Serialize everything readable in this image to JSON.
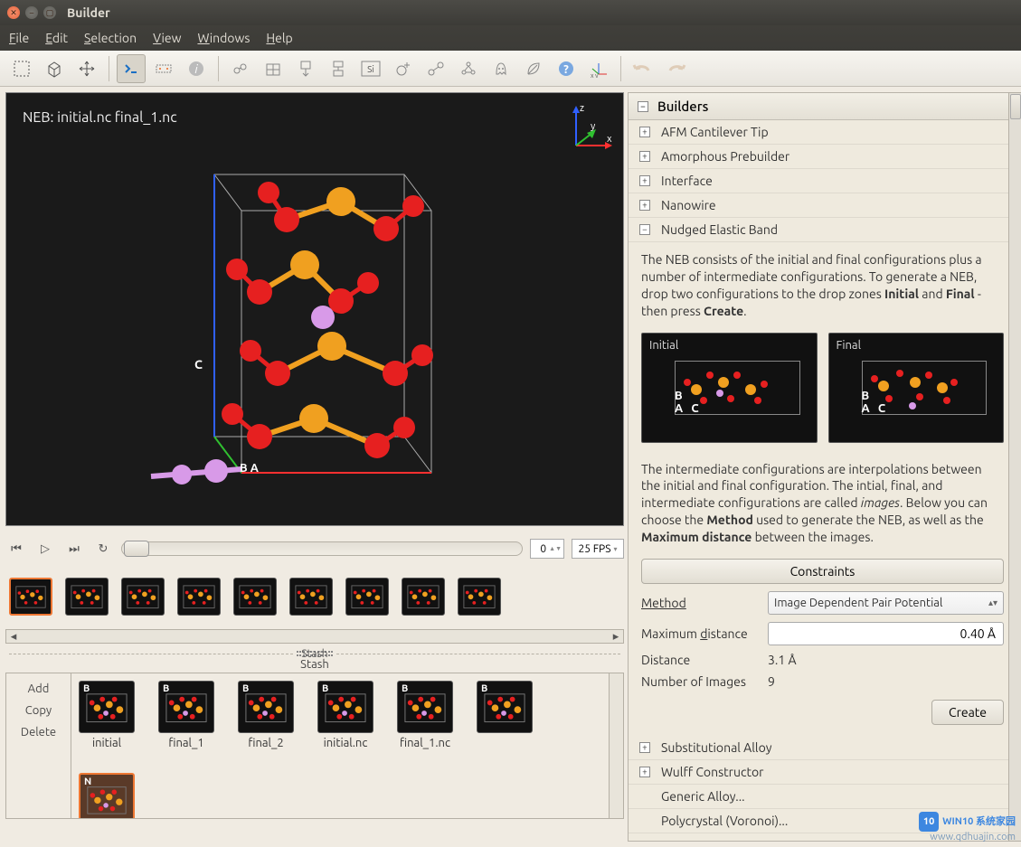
{
  "window": {
    "title": "Builder"
  },
  "menus": [
    "File",
    "Edit",
    "Selection",
    "View",
    "Windows",
    "Help"
  ],
  "toolbar_icons": [
    "select-rect-icon",
    "cube-icon",
    "move-icon",
    "sep",
    "terminal-icon",
    "measure-icon",
    "info-icon",
    "sep",
    "atoms-icon",
    "cell-icon",
    "translate-icon",
    "rotate-icon",
    "si-cell-icon",
    "add-atom-icon",
    "bond-icon",
    "group-icon",
    "ghost-icon",
    "leaf-icon",
    "help-bubble-icon",
    "xyz-orient-icon",
    "sep",
    "undo-icon",
    "redo-icon"
  ],
  "viewport": {
    "label": "NEB: initial.nc final_1.nc",
    "axes": {
      "x": "x",
      "y": "y",
      "z": "z"
    },
    "c_label": "C",
    "ab_labels": "B   A"
  },
  "playback": {
    "buttons": [
      "skip-start-icon",
      "play-icon",
      "skip-end-icon",
      "loop-icon"
    ],
    "frame_value": "0",
    "fps_value": "25 FPS"
  },
  "thumbs": {
    "count": 9,
    "active_index": 0
  },
  "stash": {
    "title": "Stash",
    "commands": {
      "add": "Add",
      "copy": "Copy",
      "delete": "Delete"
    },
    "items": [
      {
        "label": "initial",
        "corner": "B"
      },
      {
        "label": "final_1",
        "corner": "B"
      },
      {
        "label": "final_2",
        "corner": "B"
      },
      {
        "label": "initial.nc",
        "corner": "B"
      },
      {
        "label": "final_1.nc",
        "corner": "B"
      },
      {
        "label": "",
        "corner": "B"
      },
      {
        "label": "",
        "corner": "N",
        "selected": true
      }
    ]
  },
  "builders": {
    "header": "Builders",
    "items_top": [
      "AFM Cantilever Tip",
      "Amorphous Prebuilder",
      "Interface",
      "Nanowire"
    ],
    "neb_title": "Nudged Elastic Band",
    "neb_desc_1a": "The NEB consists of the initial and final configurations plus a number of intermediate configurations. To generate a NEB, drop two configurations to the drop zones ",
    "neb_desc_1b": "Initial",
    "neb_desc_1c": " and ",
    "neb_desc_1d": "Final",
    "neb_desc_1e": " - then press ",
    "neb_desc_1f": "Create",
    "neb_desc_1g": ".",
    "dz_initial": "Initial",
    "dz_final": "Final",
    "neb_desc_2a": "The intermediate configurations are interpolations between the initial and final configuration. The intial, final, and intermediate configurations are called ",
    "neb_desc_2b": "images",
    "neb_desc_2c": ". Below you can choose the ",
    "neb_desc_2d": "Method",
    "neb_desc_2e": " used to generate the NEB, as well as the ",
    "neb_desc_2f": "Maximum distance",
    "neb_desc_2g": " between the images.",
    "constraints_btn": "Constraints",
    "method_label": "Method",
    "method_value": "Image Dependent Pair Potential",
    "maxdist_label_pre": "Maximum ",
    "maxdist_label_u": "d",
    "maxdist_label_post": "istance",
    "maxdist_value": "0.40 Å",
    "distance_label": "Distance",
    "distance_value": "3.1 Å",
    "nimages_label": "Number of Images",
    "nimages_value": "9",
    "create_btn": "Create",
    "items_bottom": [
      "Substitutional Alloy",
      "Wulff Constructor",
      "Generic Alloy...",
      "Polycrystal (Voronoi)..."
    ]
  },
  "watermark": {
    "logo_text": "10",
    "line1": "WIN10 系统家园",
    "line2": "www.qdhuajin.com"
  },
  "colors": {
    "accent": "#ee7733",
    "atom_red": "#e62020",
    "atom_orange": "#f0a020",
    "atom_violet": "#d89ae8"
  }
}
